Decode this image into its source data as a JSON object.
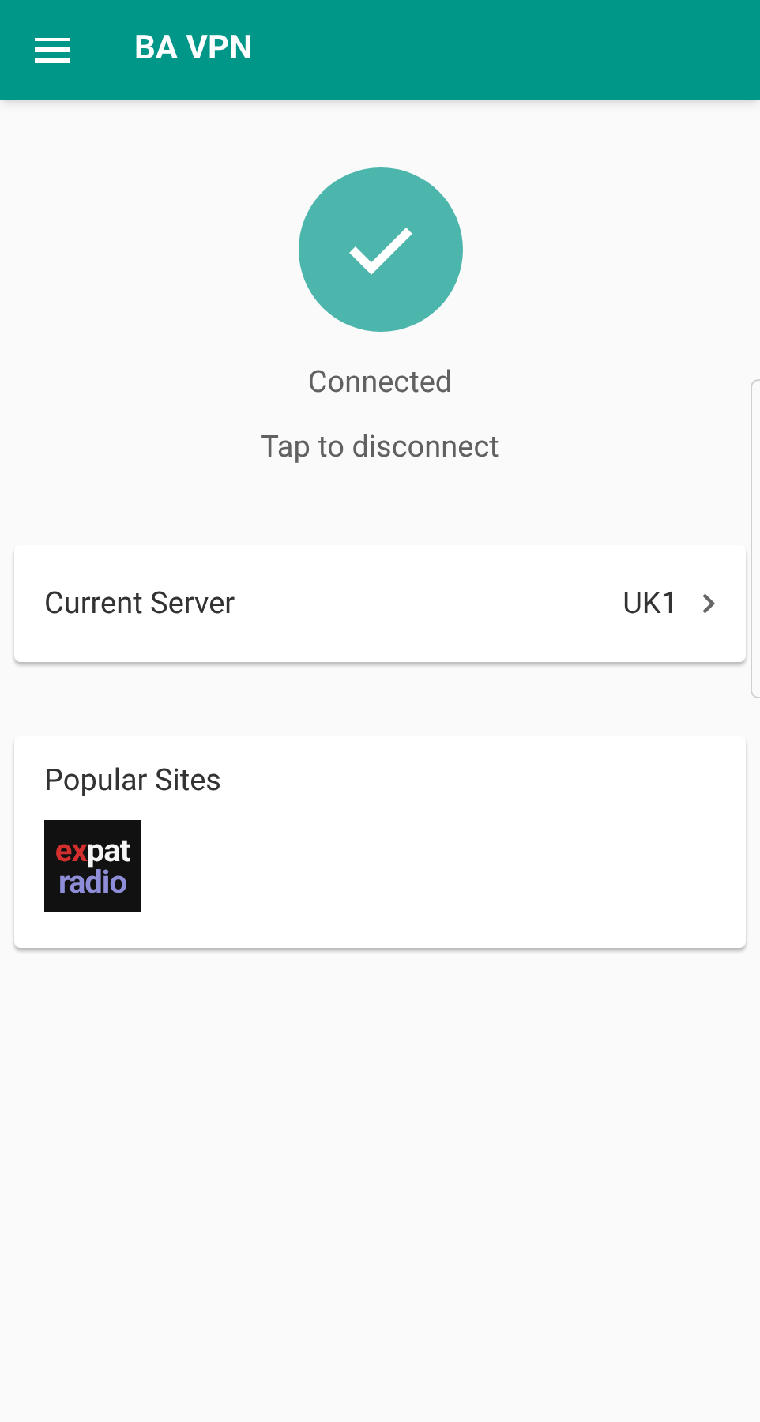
{
  "app_bar": {
    "title": "BA VPN"
  },
  "status": {
    "connected": true,
    "label": "Connected",
    "hint": "Tap to disconnect"
  },
  "current_server": {
    "label": "Current Server",
    "value": "UK1"
  },
  "popular_sites": {
    "title": "Popular Sites",
    "sites": [
      {
        "logo_lines": [
          [
            {
              "text": "ex",
              "color": "#d32f2f"
            },
            {
              "text": "pat",
              "color": "#f5f5f5"
            }
          ],
          [
            {
              "text": "radio",
              "color": "#8e8ed8"
            }
          ]
        ]
      }
    ]
  }
}
